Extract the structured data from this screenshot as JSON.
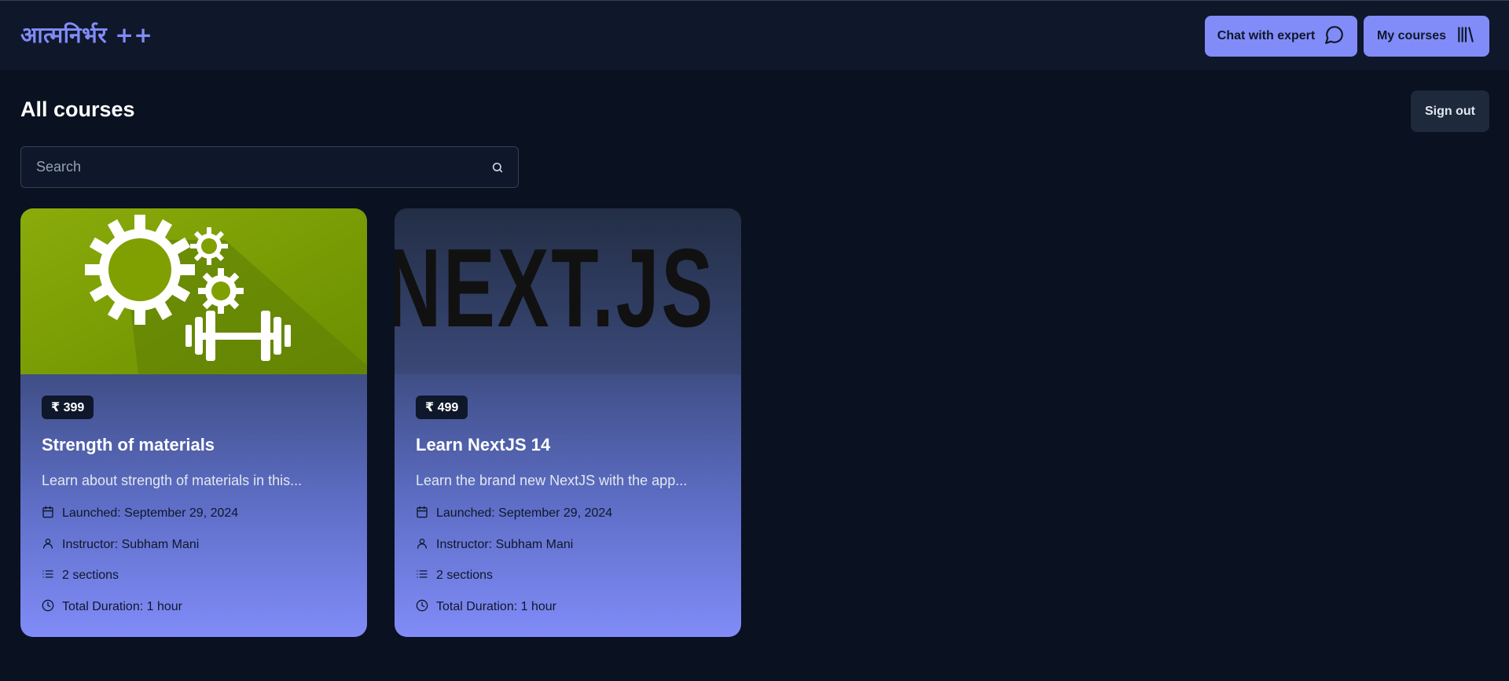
{
  "header": {
    "brand": "आत्मनिर्भर ++",
    "chat_button": "Chat with expert",
    "my_courses_button": "My courses"
  },
  "main": {
    "title": "All courses",
    "sign_out": "Sign out",
    "search": {
      "placeholder": "Search",
      "value": ""
    }
  },
  "courses": [
    {
      "price": "₹ 399",
      "title": "Strength of materials",
      "description": "Learn about strength of materials in this...",
      "launched": "Launched: September 29, 2024",
      "instructor": "Instructor: Subham Mani",
      "sections": "2 sections",
      "duration": "Total Duration: 1 hour",
      "thumbnail_text": ""
    },
    {
      "price": "₹ 499",
      "title": "Learn NextJS 14",
      "description": "Learn the brand new NextJS with the app...",
      "launched": "Launched: September 29, 2024",
      "instructor": "Instructor: Subham Mani",
      "sections": "2 sections",
      "duration": "Total Duration: 1 hour",
      "thumbnail_text": "NEXT.JS"
    }
  ],
  "colors": {
    "accent": "#818cf8",
    "background": "#0a1120",
    "header_bg": "#0f172a"
  },
  "icons": {
    "chat": "message-circle-icon",
    "my_courses": "library-icon",
    "search": "search-icon",
    "launched": "calendar-icon",
    "instructor": "user-icon",
    "sections": "list-icon",
    "duration": "clock-icon"
  }
}
